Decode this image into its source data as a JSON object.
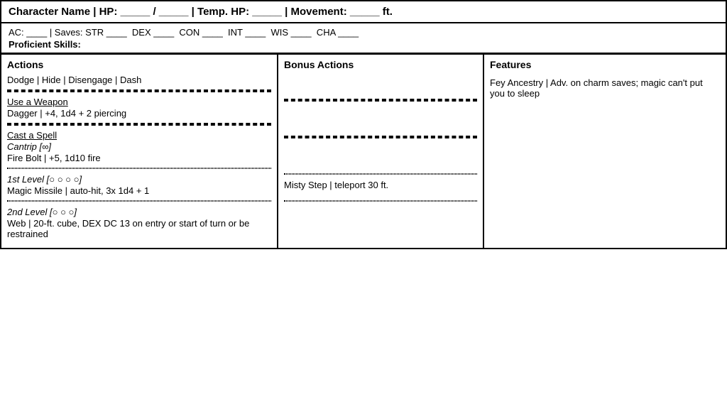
{
  "header": {
    "top_line": "Character Name | HP: _____ / _____ | Temp. HP: _____ | Movement: _____ ft.",
    "saves_line": "AC: ____ | Saves: STR ____  DEX ____  CON ____  INT ____  WIS ____  CHA ____",
    "proficient_label": "Proficient Skills:"
  },
  "columns": {
    "actions_header": "Actions",
    "bonus_header": "Bonus Actions",
    "features_header": "Features"
  },
  "actions": {
    "basic": "Dodge | Hide | Disengage | Dash",
    "use_weapon_label": "Use a Weapon",
    "use_weapon_detail": "Dagger | +4, 1d4 + 2 piercing",
    "cast_spell_label": "Cast a Spell",
    "cantrip_label": "Cantrip [∞]",
    "cantrip_detail": "Fire Bolt | +5, 1d10 fire",
    "level1_label": "1st Level [○ ○ ○ ○]",
    "level1_detail": "Magic Missile | auto-hit, 3x 1d4 + 1",
    "level2_label": "2nd Level [○ ○ ○]",
    "level2_detail": "Web | 20-ft. cube, DEX DC 13 on entry or start of turn or be restrained"
  },
  "bonus_actions": {
    "level1_detail": "Misty Step | teleport 30 ft."
  },
  "features": {
    "text": "Fey Ancestry | Adv. on charm saves; magic can't put you to sleep"
  }
}
